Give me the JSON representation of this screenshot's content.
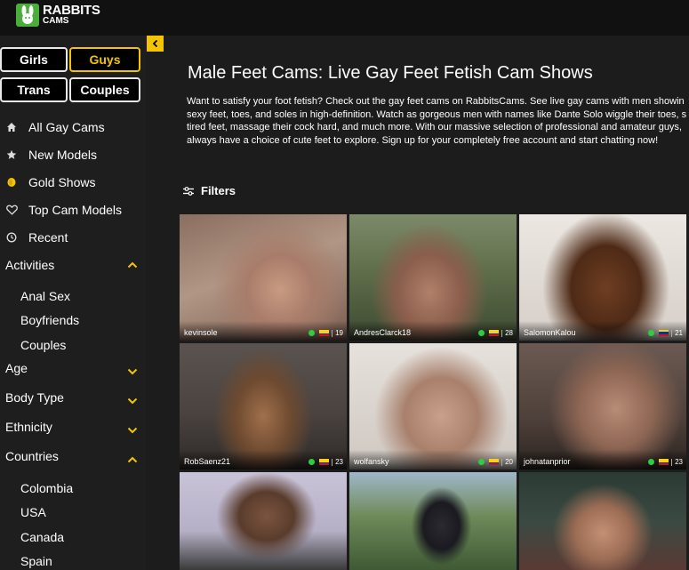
{
  "brand": {
    "line1": "RABBITS",
    "line2": "CAMS"
  },
  "gender_buttons": [
    {
      "label": "Girls",
      "active": false
    },
    {
      "label": "Guys",
      "active": true
    },
    {
      "label": "Trans",
      "active": false
    },
    {
      "label": "Couples",
      "active": false
    }
  ],
  "nav": [
    {
      "label": "All Gay Cams",
      "icon": "home-icon"
    },
    {
      "label": "New Models",
      "icon": "star-icon"
    },
    {
      "label": "Gold Shows",
      "icon": "gold-coin-icon"
    },
    {
      "label": "Top Cam Models",
      "icon": "heart-icon"
    },
    {
      "label": "Recent",
      "icon": "clock-icon"
    }
  ],
  "sections": {
    "activities": {
      "label": "Activities",
      "expanded": true,
      "items": [
        "Anal Sex",
        "Boyfriends",
        "Couples"
      ]
    },
    "age": {
      "label": "Age",
      "expanded": false
    },
    "body_type": {
      "label": "Body Type",
      "expanded": false
    },
    "ethnicity": {
      "label": "Ethnicity",
      "expanded": false
    },
    "countries": {
      "label": "Countries",
      "expanded": true,
      "items": [
        "Colombia",
        "USA",
        "Canada",
        "Spain"
      ]
    }
  },
  "main": {
    "title": "Male Feet Cams: Live Gay Feet Fetish Cam Shows",
    "description_lines": [
      "Want to satisfy your foot fetish? Check out the gay feet cams on RabbitsCams. See live gay cams with men showin",
      "sexy feet, toes, and soles in high-definition. Watch as gorgeous men with names like Dante Solo wiggle their toes, s",
      "tired feet, massage their cock hard, and much more. With our massive selection of professional and amateur guys,",
      "always have a choice of cute feet to explore. Sign up for your completely free account and start chatting now!"
    ],
    "filters_label": "Filters"
  },
  "models": [
    {
      "name": "kevinsole",
      "age": "19",
      "flag": "colombia",
      "online": true
    },
    {
      "name": "AndresClarck18",
      "age": "28",
      "flag": "colombia",
      "online": true
    },
    {
      "name": "SalomonKalou",
      "age": "21",
      "flag": "venezuela",
      "online": true
    },
    {
      "name": "RobSaenz21",
      "age": "23",
      "flag": "colombia",
      "online": true
    },
    {
      "name": "wolfansky",
      "age": "20",
      "flag": "colombia",
      "online": true
    },
    {
      "name": "johnatanprior",
      "age": "23",
      "flag": "colombia",
      "online": true
    },
    {
      "name": "",
      "age": "",
      "flag": "",
      "online": false
    },
    {
      "name": "",
      "age": "",
      "flag": "",
      "online": false
    },
    {
      "name": "",
      "age": "",
      "flag": "",
      "online": false
    }
  ],
  "colors": {
    "accent": "#f5c400",
    "brand_green": "#4cae3a",
    "online": "#2ecc40",
    "background": "#1c1c1c"
  }
}
